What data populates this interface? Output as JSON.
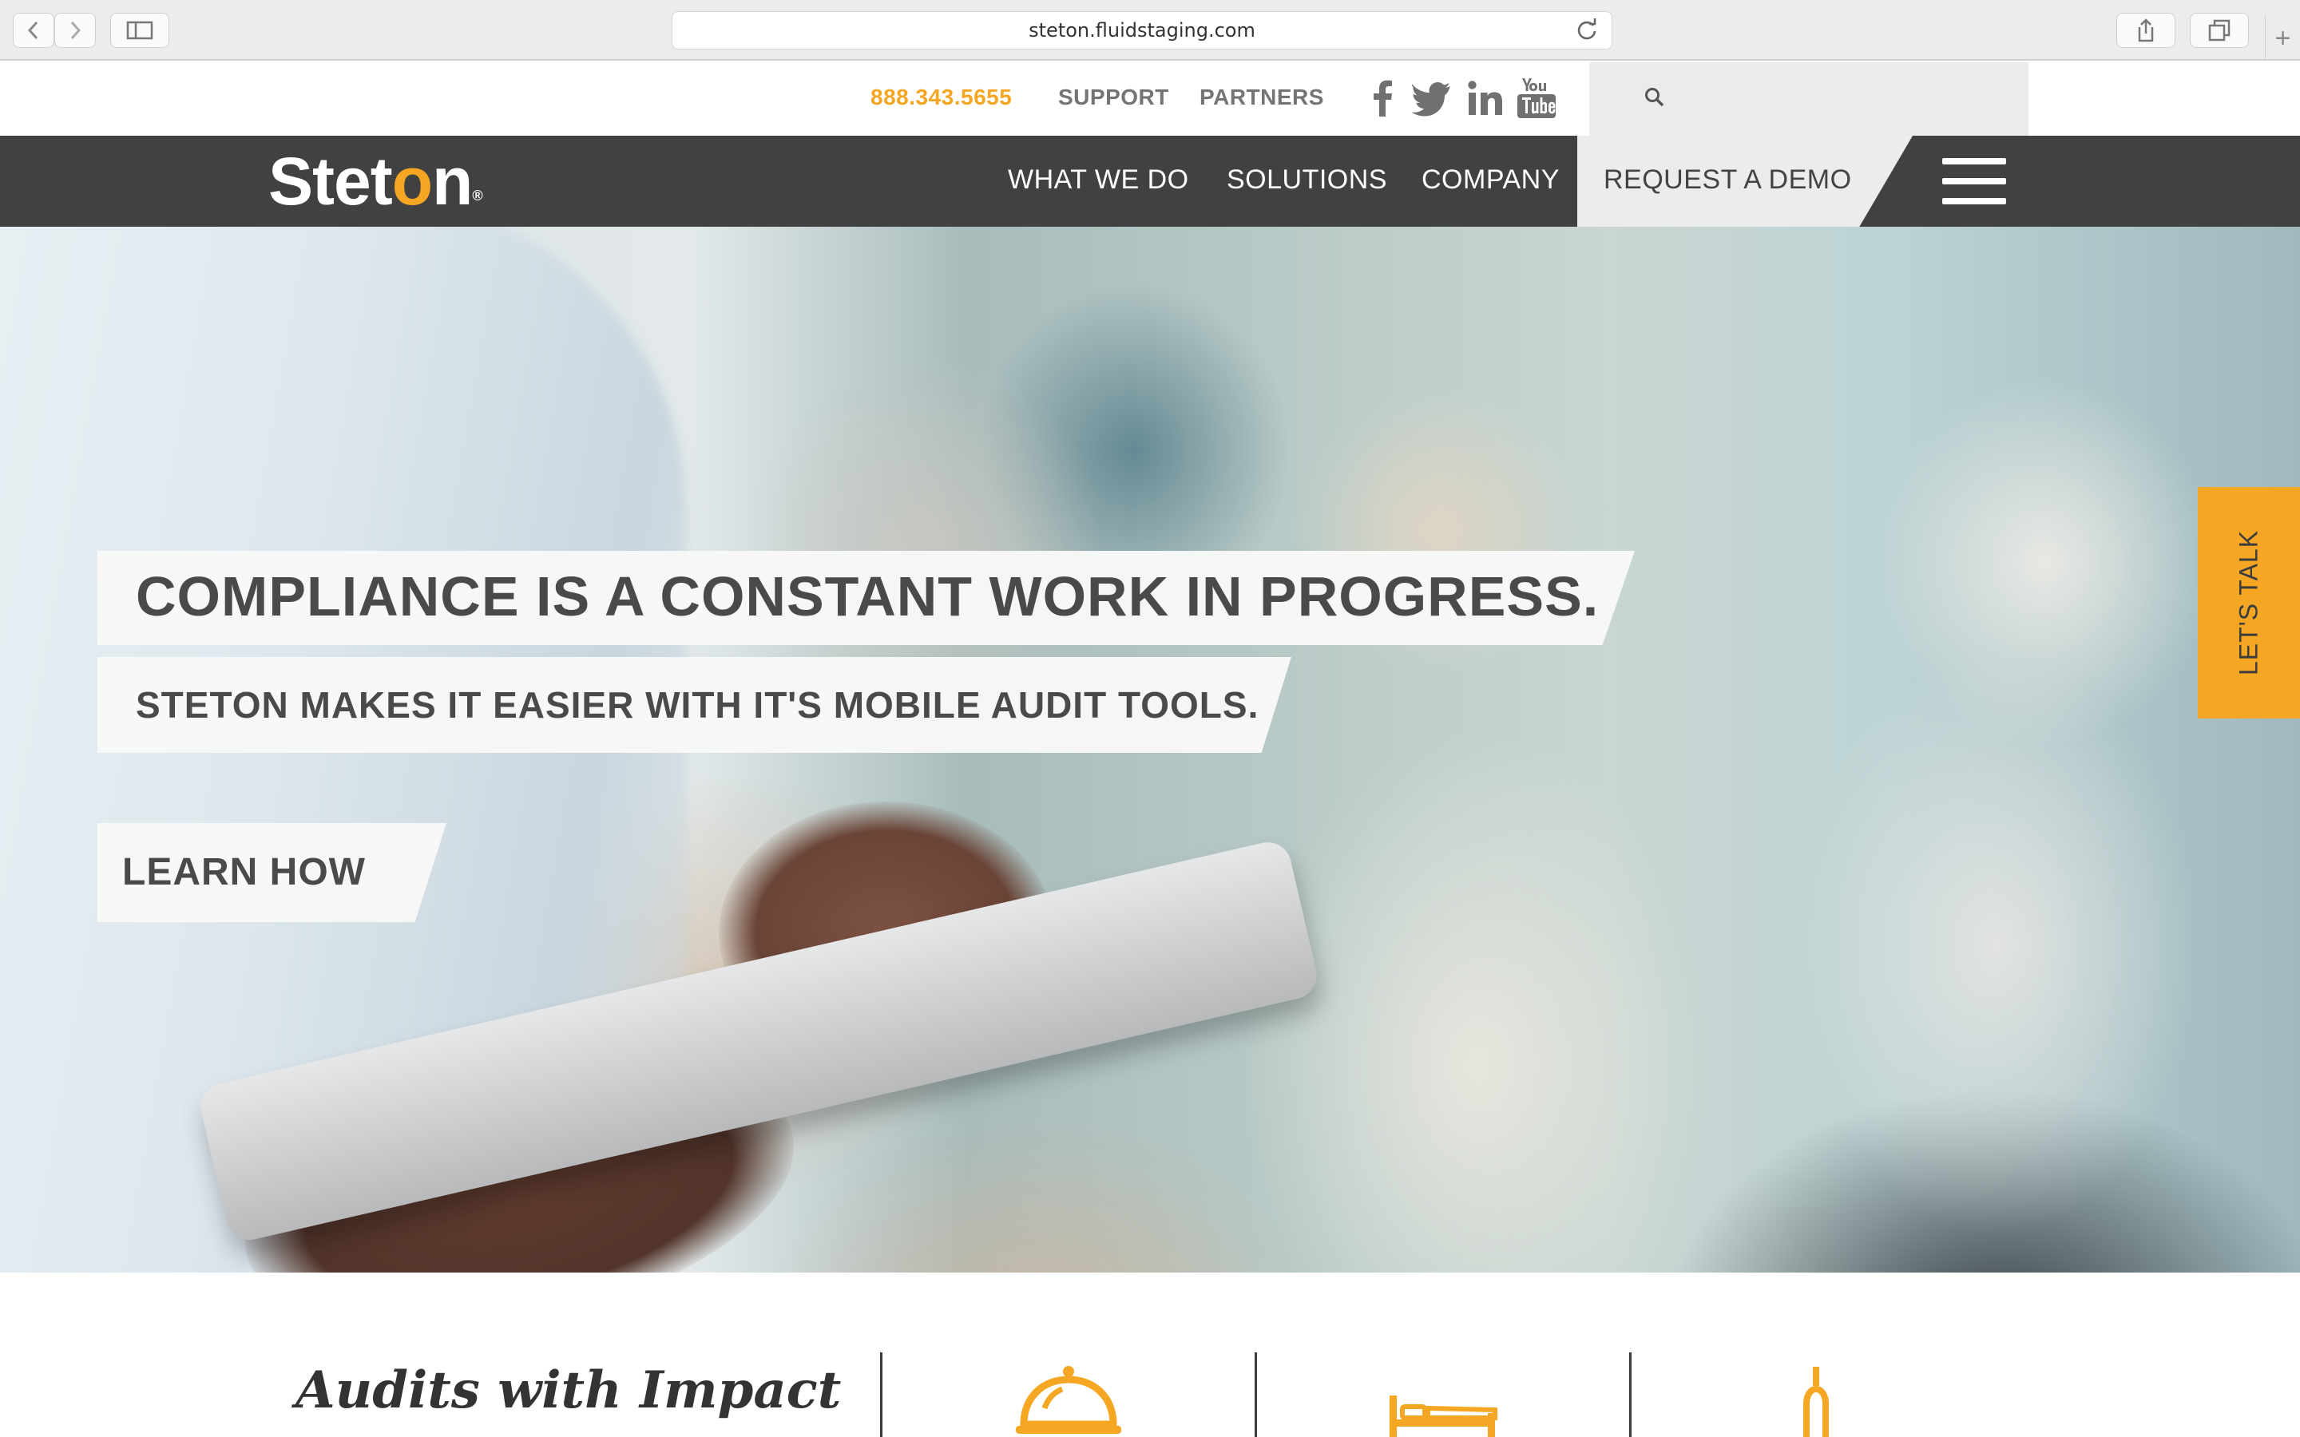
{
  "browser": {
    "url": "steton.fluidstaging.com",
    "newtab_glyph": "+"
  },
  "utility": {
    "phone": "888.343.5655",
    "support": "SUPPORT",
    "partners": "PARTNERS",
    "social": [
      "facebook-icon",
      "twitter-icon",
      "linkedin-icon",
      "youtube-icon"
    ]
  },
  "nav": {
    "logo_before": "Stet",
    "logo_o": "o",
    "logo_after": "n",
    "logo_reg": "®",
    "items": [
      "WHAT WE DO",
      "SOLUTIONS",
      "COMPANY"
    ],
    "cta": "REQUEST A DEMO"
  },
  "hero": {
    "headline": "COMPLIANCE IS A CONSTANT WORK IN PROGRESS.",
    "subheadline": "STETON MAKES IT EASIER WITH IT'S MOBILE AUDIT TOOLS.",
    "cta": "LEARN HOW",
    "side_tab": "LET'S TALK"
  },
  "section": {
    "title": "Audits with Impact",
    "icons": [
      "service-bell-icon",
      "bed-icon",
      "thermometer-icon"
    ]
  },
  "colors": {
    "accent": "#f5a623",
    "nav_bg": "#414141",
    "text_dark": "#4a4a4a"
  }
}
